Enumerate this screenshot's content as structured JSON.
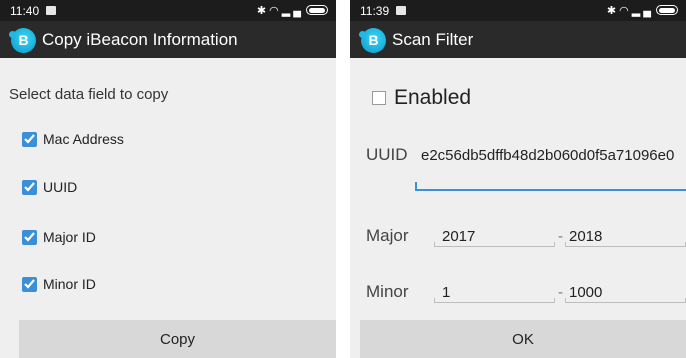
{
  "left": {
    "status": {
      "time": "11:40"
    },
    "title": "Copy iBeacon Information",
    "logo_letter": "B",
    "prompt": "Select data field to copy",
    "fields": [
      {
        "label": "Mac Address",
        "checked": true
      },
      {
        "label": "UUID",
        "checked": true
      },
      {
        "label": "Major ID",
        "checked": true
      },
      {
        "label": "Minor ID",
        "checked": true
      }
    ],
    "button": "Copy"
  },
  "right": {
    "status": {
      "time": "11:39"
    },
    "title": "Scan Filter",
    "logo_letter": "B",
    "enabled": {
      "label": "Enabled",
      "checked": false
    },
    "uuid": {
      "label": "UUID",
      "value": "e2c56db5dffb48d2b060d0f5a71096e0"
    },
    "major": {
      "label": "Major",
      "from": "2017",
      "sep": "-",
      "to": "2018"
    },
    "minor": {
      "label": "Minor",
      "from": "1",
      "sep": "-",
      "to": "1000"
    },
    "button": "OK"
  },
  "colors": {
    "accent": "#3b8fd6",
    "actionbar": "#2a2a2a",
    "statusbar": "#1c1c1c",
    "button": "#d8d8d8"
  }
}
